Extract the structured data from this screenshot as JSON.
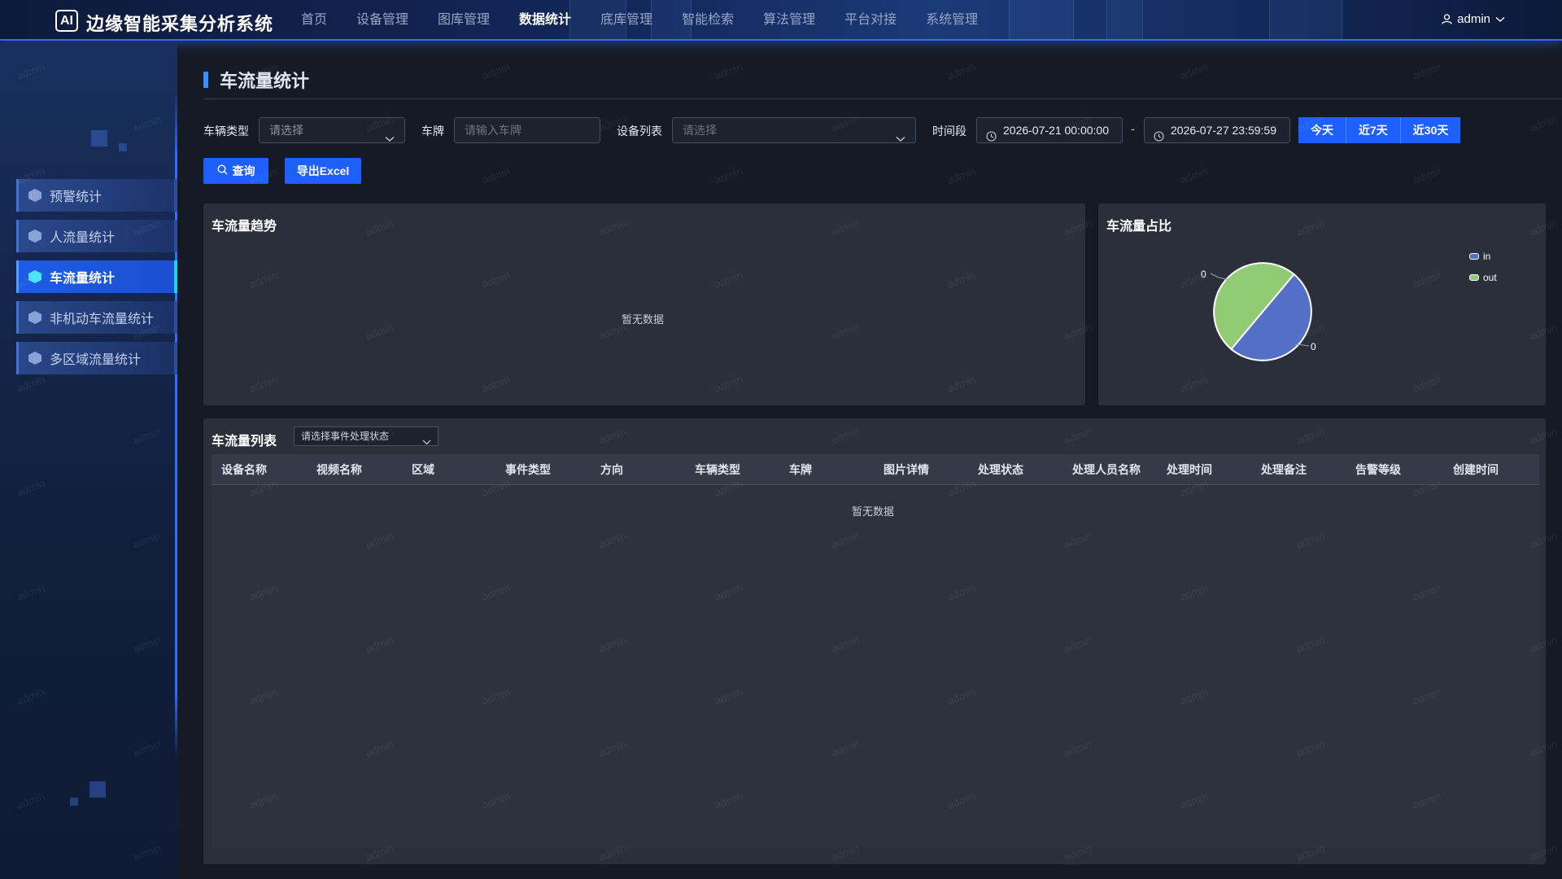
{
  "header": {
    "logo": "AI",
    "app_title": "边缘智能采集分析系统",
    "nav": [
      "首页",
      "设备管理",
      "图库管理",
      "数据统计",
      "底库管理",
      "智能检索",
      "算法管理",
      "平台对接",
      "系统管理"
    ],
    "active_nav": "数据统计",
    "user": "admin"
  },
  "sidebar": {
    "items": [
      {
        "label": "预警统计",
        "active": false
      },
      {
        "label": "人流量统计",
        "active": false
      },
      {
        "label": "车流量统计",
        "active": true
      },
      {
        "label": "非机动车流量统计",
        "active": false
      },
      {
        "label": "多区域流量统计",
        "active": false
      }
    ]
  },
  "page": {
    "title": "车流量统计"
  },
  "filters": {
    "vehicle_type_label": "车辆类型",
    "vehicle_type_value": "请选择",
    "plate_label": "车牌",
    "plate_placeholder": "请输入车牌",
    "device_label": "设备列表",
    "device_value": "请选择",
    "period_label": "时间段",
    "start_time": "2026-07-21 00:00:00",
    "separator": "-",
    "end_time": "2026-07-27 23:59:59",
    "range_buttons": [
      "今天",
      "近7天",
      "近30天"
    ],
    "query_button": "查询",
    "export_button": "导出Excel"
  },
  "trend_panel": {
    "title": "车流量趋势",
    "empty_text": "暂无数据"
  },
  "ratio_panel": {
    "title": "车流量占比",
    "label_in": "0",
    "label_out": "0",
    "legend": [
      {
        "name": "in",
        "color": "#5470c6"
      },
      {
        "name": "out",
        "color": "#91cc75"
      }
    ]
  },
  "list_panel": {
    "title": "车流量列表",
    "status_select": "请选择事件处理状态",
    "columns": [
      "设备名称",
      "视频名称",
      "区域",
      "事件类型",
      "方向",
      "车辆类型",
      "车牌",
      "图片详情",
      "处理状态",
      "处理人员名称",
      "处理时间",
      "处理备注",
      "告警等级",
      "创建时间"
    ],
    "empty_text": "暂无数据"
  },
  "watermark": "admin",
  "colors": {
    "accent": "#1e60ff",
    "active_indicator": "#18d6f0",
    "panel": "#2a2f3a",
    "background": "#151a24",
    "pie_in": "#5470c6",
    "pie_out": "#91cc75"
  },
  "chart_data": {
    "type": "pie",
    "title": "车流量占比",
    "series": [
      {
        "name": "in",
        "value": 0
      },
      {
        "name": "out",
        "value": 0
      }
    ],
    "legend_position": "top-right"
  }
}
